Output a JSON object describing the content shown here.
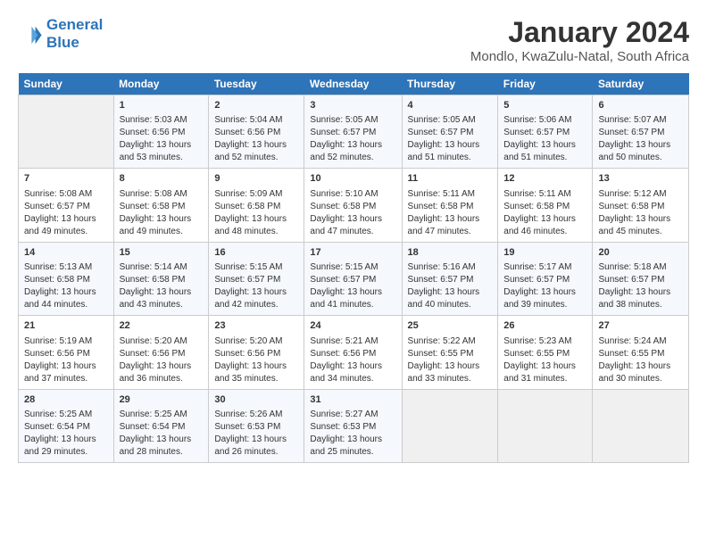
{
  "logo": {
    "line1": "General",
    "line2": "Blue"
  },
  "title": "January 2024",
  "subtitle": "Mondlo, KwaZulu-Natal, South Africa",
  "days_of_week": [
    "Sunday",
    "Monday",
    "Tuesday",
    "Wednesday",
    "Thursday",
    "Friday",
    "Saturday"
  ],
  "weeks": [
    [
      {
        "day": "",
        "sunrise": "",
        "sunset": "",
        "daylight": ""
      },
      {
        "day": "1",
        "sunrise": "Sunrise: 5:03 AM",
        "sunset": "Sunset: 6:56 PM",
        "daylight": "Daylight: 13 hours and 53 minutes."
      },
      {
        "day": "2",
        "sunrise": "Sunrise: 5:04 AM",
        "sunset": "Sunset: 6:56 PM",
        "daylight": "Daylight: 13 hours and 52 minutes."
      },
      {
        "day": "3",
        "sunrise": "Sunrise: 5:05 AM",
        "sunset": "Sunset: 6:57 PM",
        "daylight": "Daylight: 13 hours and 52 minutes."
      },
      {
        "day": "4",
        "sunrise": "Sunrise: 5:05 AM",
        "sunset": "Sunset: 6:57 PM",
        "daylight": "Daylight: 13 hours and 51 minutes."
      },
      {
        "day": "5",
        "sunrise": "Sunrise: 5:06 AM",
        "sunset": "Sunset: 6:57 PM",
        "daylight": "Daylight: 13 hours and 51 minutes."
      },
      {
        "day": "6",
        "sunrise": "Sunrise: 5:07 AM",
        "sunset": "Sunset: 6:57 PM",
        "daylight": "Daylight: 13 hours and 50 minutes."
      }
    ],
    [
      {
        "day": "7",
        "sunrise": "Sunrise: 5:08 AM",
        "sunset": "Sunset: 6:57 PM",
        "daylight": "Daylight: 13 hours and 49 minutes."
      },
      {
        "day": "8",
        "sunrise": "Sunrise: 5:08 AM",
        "sunset": "Sunset: 6:58 PM",
        "daylight": "Daylight: 13 hours and 49 minutes."
      },
      {
        "day": "9",
        "sunrise": "Sunrise: 5:09 AM",
        "sunset": "Sunset: 6:58 PM",
        "daylight": "Daylight: 13 hours and 48 minutes."
      },
      {
        "day": "10",
        "sunrise": "Sunrise: 5:10 AM",
        "sunset": "Sunset: 6:58 PM",
        "daylight": "Daylight: 13 hours and 47 minutes."
      },
      {
        "day": "11",
        "sunrise": "Sunrise: 5:11 AM",
        "sunset": "Sunset: 6:58 PM",
        "daylight": "Daylight: 13 hours and 47 minutes."
      },
      {
        "day": "12",
        "sunrise": "Sunrise: 5:11 AM",
        "sunset": "Sunset: 6:58 PM",
        "daylight": "Daylight: 13 hours and 46 minutes."
      },
      {
        "day": "13",
        "sunrise": "Sunrise: 5:12 AM",
        "sunset": "Sunset: 6:58 PM",
        "daylight": "Daylight: 13 hours and 45 minutes."
      }
    ],
    [
      {
        "day": "14",
        "sunrise": "Sunrise: 5:13 AM",
        "sunset": "Sunset: 6:58 PM",
        "daylight": "Daylight: 13 hours and 44 minutes."
      },
      {
        "day": "15",
        "sunrise": "Sunrise: 5:14 AM",
        "sunset": "Sunset: 6:58 PM",
        "daylight": "Daylight: 13 hours and 43 minutes."
      },
      {
        "day": "16",
        "sunrise": "Sunrise: 5:15 AM",
        "sunset": "Sunset: 6:57 PM",
        "daylight": "Daylight: 13 hours and 42 minutes."
      },
      {
        "day": "17",
        "sunrise": "Sunrise: 5:15 AM",
        "sunset": "Sunset: 6:57 PM",
        "daylight": "Daylight: 13 hours and 41 minutes."
      },
      {
        "day": "18",
        "sunrise": "Sunrise: 5:16 AM",
        "sunset": "Sunset: 6:57 PM",
        "daylight": "Daylight: 13 hours and 40 minutes."
      },
      {
        "day": "19",
        "sunrise": "Sunrise: 5:17 AM",
        "sunset": "Sunset: 6:57 PM",
        "daylight": "Daylight: 13 hours and 39 minutes."
      },
      {
        "day": "20",
        "sunrise": "Sunrise: 5:18 AM",
        "sunset": "Sunset: 6:57 PM",
        "daylight": "Daylight: 13 hours and 38 minutes."
      }
    ],
    [
      {
        "day": "21",
        "sunrise": "Sunrise: 5:19 AM",
        "sunset": "Sunset: 6:56 PM",
        "daylight": "Daylight: 13 hours and 37 minutes."
      },
      {
        "day": "22",
        "sunrise": "Sunrise: 5:20 AM",
        "sunset": "Sunset: 6:56 PM",
        "daylight": "Daylight: 13 hours and 36 minutes."
      },
      {
        "day": "23",
        "sunrise": "Sunrise: 5:20 AM",
        "sunset": "Sunset: 6:56 PM",
        "daylight": "Daylight: 13 hours and 35 minutes."
      },
      {
        "day": "24",
        "sunrise": "Sunrise: 5:21 AM",
        "sunset": "Sunset: 6:56 PM",
        "daylight": "Daylight: 13 hours and 34 minutes."
      },
      {
        "day": "25",
        "sunrise": "Sunrise: 5:22 AM",
        "sunset": "Sunset: 6:55 PM",
        "daylight": "Daylight: 13 hours and 33 minutes."
      },
      {
        "day": "26",
        "sunrise": "Sunrise: 5:23 AM",
        "sunset": "Sunset: 6:55 PM",
        "daylight": "Daylight: 13 hours and 31 minutes."
      },
      {
        "day": "27",
        "sunrise": "Sunrise: 5:24 AM",
        "sunset": "Sunset: 6:55 PM",
        "daylight": "Daylight: 13 hours and 30 minutes."
      }
    ],
    [
      {
        "day": "28",
        "sunrise": "Sunrise: 5:25 AM",
        "sunset": "Sunset: 6:54 PM",
        "daylight": "Daylight: 13 hours and 29 minutes."
      },
      {
        "day": "29",
        "sunrise": "Sunrise: 5:25 AM",
        "sunset": "Sunset: 6:54 PM",
        "daylight": "Daylight: 13 hours and 28 minutes."
      },
      {
        "day": "30",
        "sunrise": "Sunrise: 5:26 AM",
        "sunset": "Sunset: 6:53 PM",
        "daylight": "Daylight: 13 hours and 26 minutes."
      },
      {
        "day": "31",
        "sunrise": "Sunrise: 5:27 AM",
        "sunset": "Sunset: 6:53 PM",
        "daylight": "Daylight: 13 hours and 25 minutes."
      },
      {
        "day": "",
        "sunrise": "",
        "sunset": "",
        "daylight": ""
      },
      {
        "day": "",
        "sunrise": "",
        "sunset": "",
        "daylight": ""
      },
      {
        "day": "",
        "sunrise": "",
        "sunset": "",
        "daylight": ""
      }
    ]
  ]
}
